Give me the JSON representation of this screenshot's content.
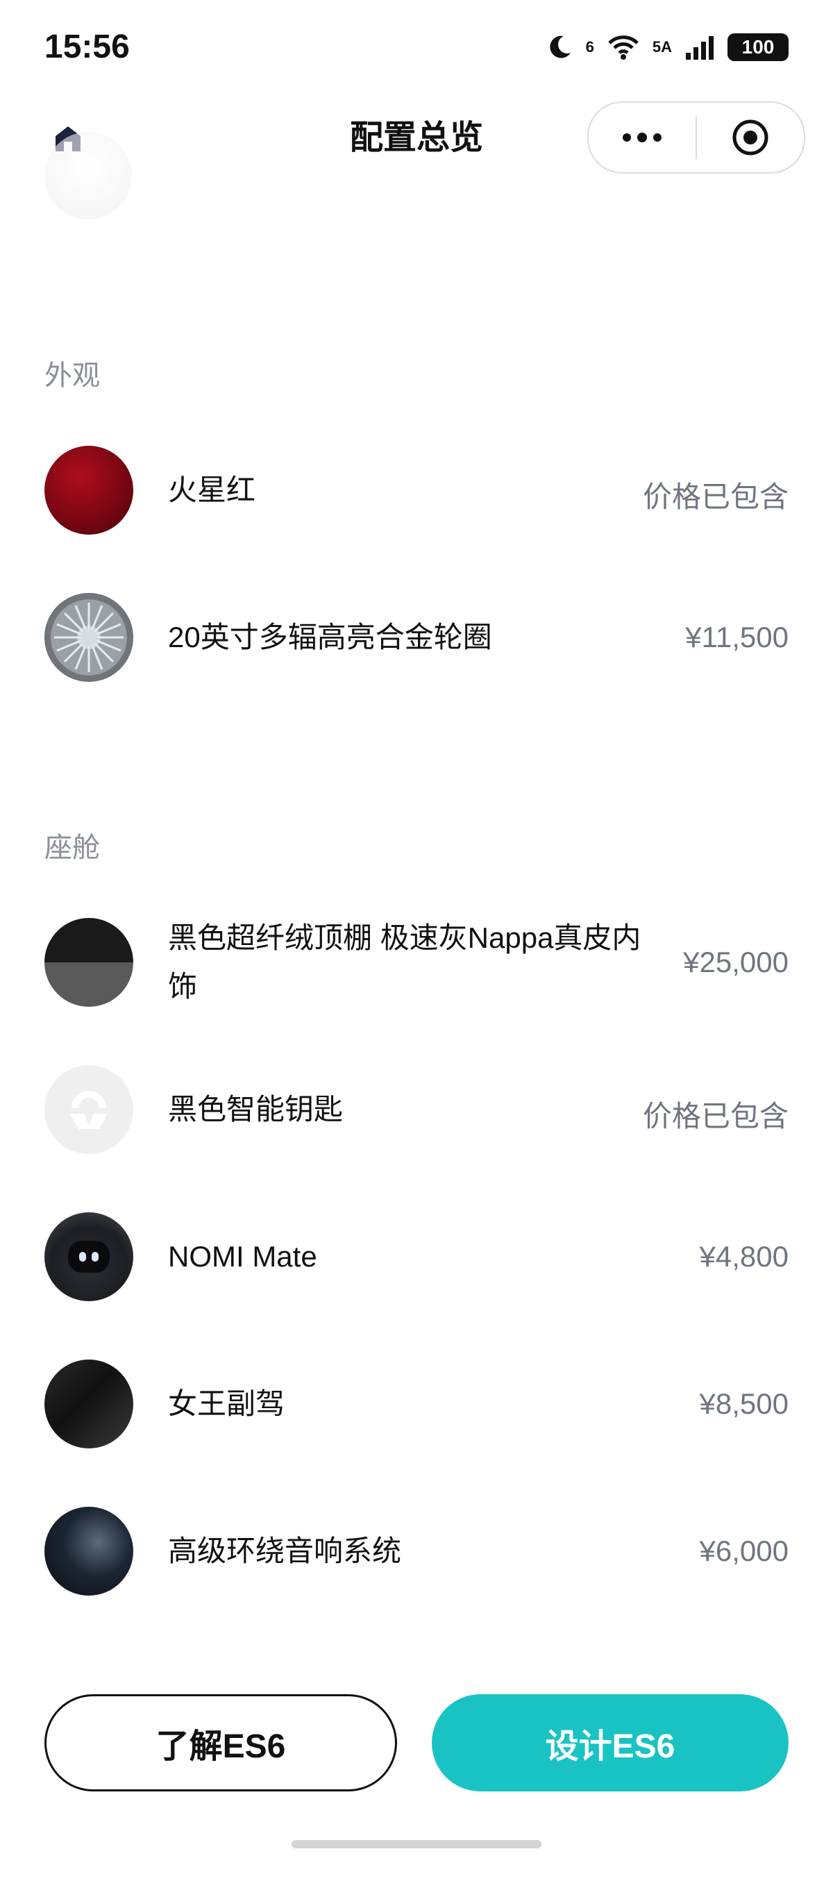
{
  "status_bar": {
    "time": "15:56",
    "wifi_label": "6",
    "signal_label": "5A",
    "battery": "100"
  },
  "nav": {
    "title": "配置总览",
    "icons": {
      "home": "home-icon",
      "more": "more-dots-icon",
      "target": "target-icon"
    }
  },
  "sections": {
    "exterior": {
      "title": "外观",
      "items": [
        {
          "name": "火星红",
          "price": "价格已包含"
        },
        {
          "name": "20英寸多辐高亮合金轮圈",
          "price": "¥11,500"
        }
      ]
    },
    "cabin": {
      "title": "座舱",
      "items": [
        {
          "name": "黑色超纤绒顶棚 极速灰Nappa真皮内饰",
          "price": "¥25,000"
        },
        {
          "name": "黑色智能钥匙",
          "price": "价格已包含"
        },
        {
          "name": "NOMI Mate",
          "price": "¥4,800"
        },
        {
          "name": "女王副驾",
          "price": "¥8,500"
        },
        {
          "name": "高级环绕音响系统",
          "price": "¥6,000"
        }
      ]
    }
  },
  "buttons": {
    "learn": "了解ES6",
    "design": "设计ES6"
  },
  "colors": {
    "primary": "#19c3c3",
    "price_gray": "#6f7580",
    "section_gray": "#8a8f99",
    "home_icon": "#1b2240"
  }
}
